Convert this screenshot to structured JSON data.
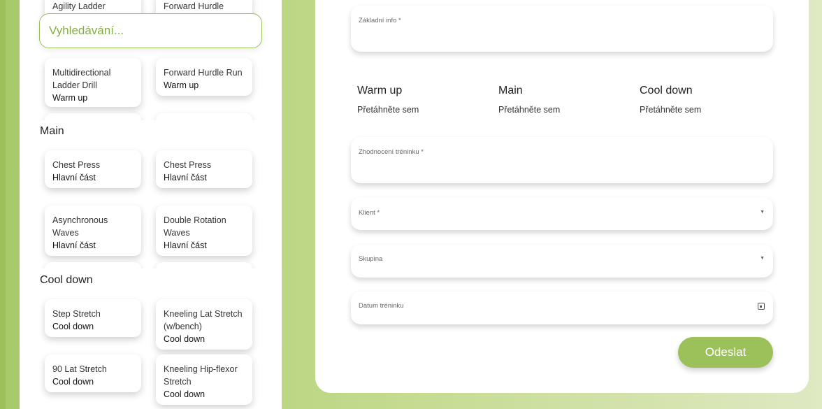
{
  "search": {
    "placeholder": "Vyhledávání..."
  },
  "exercises": {
    "warmup": {
      "partial": [
        {
          "name": "Agility Ladder",
          "category": ""
        },
        {
          "name": "Forward Hurdle",
          "category": ""
        }
      ],
      "cards": [
        {
          "name": "Multidirectional Ladder Drill",
          "category": "Warm up"
        },
        {
          "name": "Forward Hurdle Run",
          "category": "Warm up"
        }
      ]
    },
    "main": {
      "title": "Main",
      "cards": [
        {
          "name": "Chest Press",
          "category": "Hlavní část"
        },
        {
          "name": "Chest Press",
          "category": "Hlavní část"
        },
        {
          "name": "Asynchronous Waves",
          "category": "Hlavní část"
        },
        {
          "name": "Double Rotation Waves",
          "category": "Hlavní část"
        }
      ]
    },
    "cooldown": {
      "title": "Cool down",
      "cards": [
        {
          "name": "Step Stretch",
          "category": "Cool down"
        },
        {
          "name": "Kneeling Lat Stretch (w/bench)",
          "category": "Cool down"
        },
        {
          "name": "90 Lat Stretch",
          "category": "Cool down"
        },
        {
          "name": "Kneeling Hip-flexor Stretch",
          "category": "Cool down"
        }
      ]
    }
  },
  "form": {
    "basic_info_label": "Základní info *",
    "columns": [
      {
        "title": "Warm up",
        "hint": "Přetáhněte sem"
      },
      {
        "title": "Main",
        "hint": "Přetáhněte sem"
      },
      {
        "title": "Cool down",
        "hint": "Přetáhněte sem"
      }
    ],
    "evaluation_label": "Zhodnocení tréninku *",
    "client_label": "Klient *",
    "group_label": "Skupina",
    "date_label": "Datum tréninku",
    "submit_label": "Odeslat"
  },
  "colors": {
    "accent": "#9dc15a",
    "accent_text": "#86ad45"
  }
}
